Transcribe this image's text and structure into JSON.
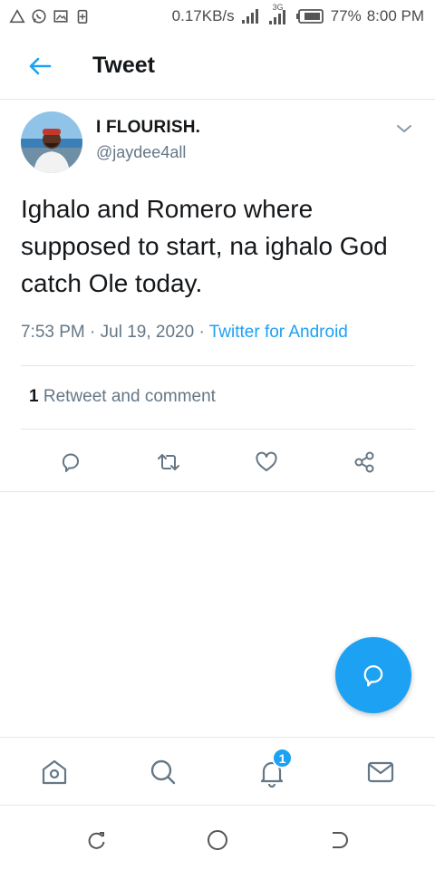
{
  "status_bar": {
    "speed": "0.17KB/s",
    "network_label": "3G",
    "battery": "77%",
    "time": "8:00 PM"
  },
  "header": {
    "title": "Tweet"
  },
  "tweet": {
    "author_name": "I FLOURISH.",
    "author_handle": "@jaydee4all",
    "text": "Ighalo and Romero where supposed to start, na ighalo God catch Ole today.",
    "time": "7:53 PM",
    "date": "Jul 19, 2020",
    "separator": "·",
    "source": "Twitter for Android",
    "retweet_count": "1",
    "retweet_label": "Retweet and comment"
  },
  "actions": [
    "reply-icon",
    "retweet-icon",
    "like-icon",
    "share-icon"
  ],
  "bottom_nav": {
    "items": [
      "home-icon",
      "search-icon",
      "notifications-icon",
      "messages-icon"
    ],
    "notifications_badge": "1"
  },
  "colors": {
    "accent": "#1da1f2",
    "text": "#14171a",
    "secondary": "#657786",
    "divider": "#e1e8ed"
  }
}
